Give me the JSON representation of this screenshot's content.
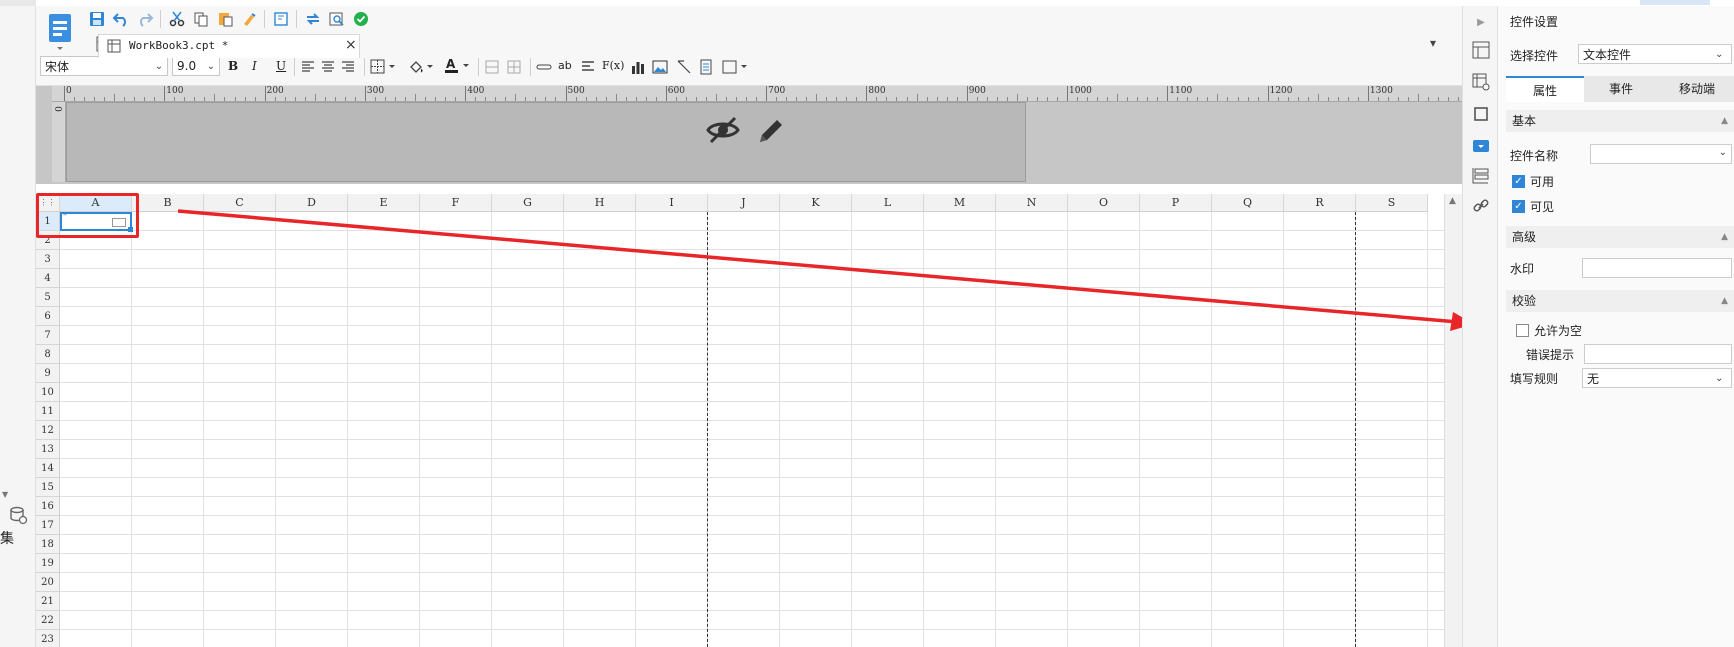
{
  "app": {
    "colors": {
      "accent": "#2f86d6",
      "annotation": "#e8262a",
      "ok": "#22b14c"
    }
  },
  "left": {
    "vertical_label": "集"
  },
  "toolbar": {
    "icons": [
      "save-icon",
      "undo-icon",
      "redo-icon",
      "cut-icon",
      "copy-icon",
      "paste-icon",
      "format-painter-icon",
      "preview-icon",
      "sync-icon",
      "search-preview-icon",
      "check-icon"
    ]
  },
  "tab": {
    "title": "WorkBook3.cpt *"
  },
  "format": {
    "font_name": "宋体",
    "font_size": "9.0",
    "bold": "B",
    "italic": "I",
    "underline": "U",
    "text_sample": "ab",
    "formula": "F(x)"
  },
  "ruler": {
    "ticks": [
      "0",
      "100",
      "200",
      "300",
      "400",
      "500",
      "600",
      "700",
      "800",
      "900",
      "1000",
      "1100",
      "1200",
      "1300"
    ],
    "vertical_tick": "0"
  },
  "grid": {
    "columns": [
      "A",
      "B",
      "C",
      "D",
      "E",
      "F",
      "G",
      "H",
      "I",
      "J",
      "K",
      "L",
      "M",
      "N",
      "O",
      "P",
      "Q",
      "R",
      "S"
    ],
    "rows": [
      "1",
      "2",
      "3",
      "4",
      "5",
      "6",
      "7",
      "8",
      "9",
      "10",
      "11",
      "12",
      "13",
      "14",
      "15",
      "16",
      "17",
      "18",
      "19",
      "20",
      "21",
      "22",
      "23"
    ],
    "selected_cell": "A1"
  },
  "panel": {
    "title": "控件设置",
    "select_label": "选择控件",
    "select_value": "文本控件",
    "tabs": [
      "属性",
      "事件",
      "移动端"
    ],
    "sections": {
      "basic": "基本",
      "advanced": "高级",
      "validation": "校验"
    },
    "fields": {
      "widget_name": "控件名称",
      "enabled": "可用",
      "visible": "可见",
      "watermark": "水印",
      "allow_empty": "允许为空",
      "error_hint": "错误提示",
      "fill_rule": "填写规则",
      "fill_rule_value": "无"
    }
  }
}
